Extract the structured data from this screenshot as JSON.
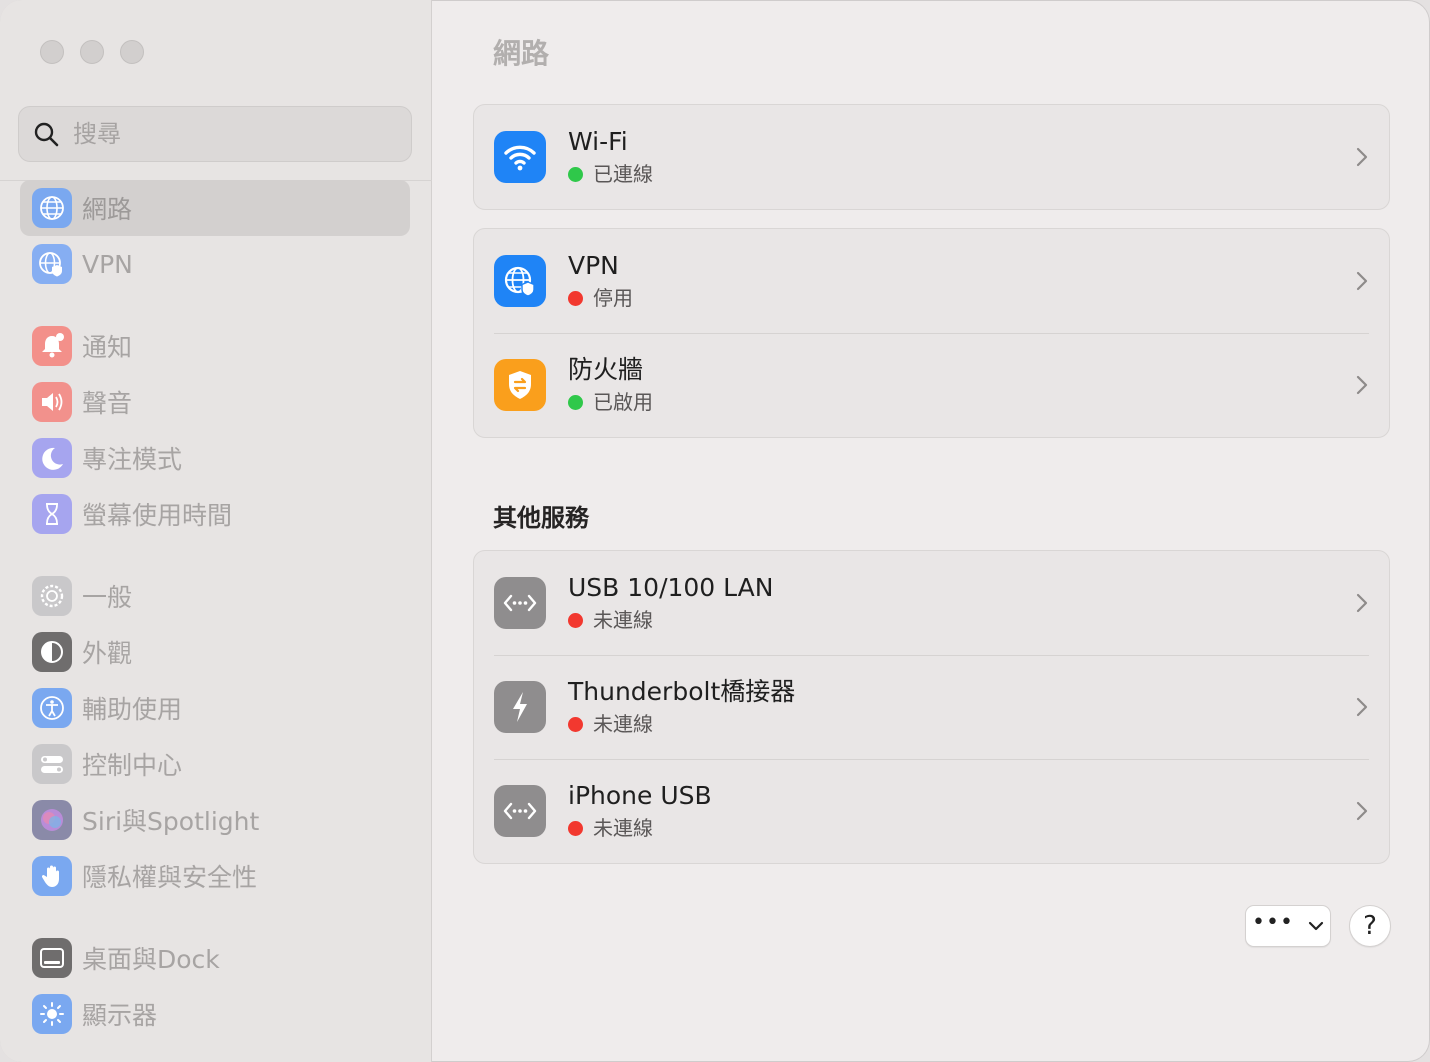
{
  "window": {
    "title": "網路"
  },
  "search": {
    "placeholder": "搜尋"
  },
  "sidebar": {
    "items": [
      {
        "label": "網路",
        "icon": "globe-icon",
        "color": "#2f7cf6",
        "selected": true
      },
      {
        "label": "VPN",
        "icon": "vpn-globe-icon",
        "color": "#2f7cf6"
      },
      {
        "label": "通知",
        "icon": "bell-icon",
        "color": "#f0453a"
      },
      {
        "label": "聲音",
        "icon": "speaker-icon",
        "color": "#f0453a"
      },
      {
        "label": "專注模式",
        "icon": "moon-icon",
        "color": "#5e5ce6"
      },
      {
        "label": "螢幕使用時間",
        "icon": "hourglass-icon",
        "color": "#5e5ce6"
      },
      {
        "label": "一般",
        "icon": "gear-icon",
        "color": "#9a9a9e"
      },
      {
        "label": "外觀",
        "icon": "appearance-icon",
        "color": "#1c1c1e"
      },
      {
        "label": "輔助使用",
        "icon": "accessibility-icon",
        "color": "#2f7cf6"
      },
      {
        "label": "控制中心",
        "icon": "control-center-icon",
        "color": "#9a9a9e"
      },
      {
        "label": "Siri與Spotlight",
        "icon": "siri-icon",
        "color": "#c251d6"
      },
      {
        "label": "隱私權與安全性",
        "icon": "hand-icon",
        "color": "#2f7cf6"
      },
      {
        "label": "桌面與Dock",
        "icon": "dock-icon",
        "color": "#1c1c1e"
      },
      {
        "label": "顯示器",
        "icon": "sun-icon",
        "color": "#2f7cf6"
      }
    ]
  },
  "main": {
    "title": "網路",
    "services": [
      {
        "name": "Wi-Fi",
        "status": "已連線",
        "status_color": "green",
        "icon": "wifi-icon"
      },
      {
        "name": "VPN",
        "status": "停用",
        "status_color": "red",
        "icon": "vpn-globe-icon"
      },
      {
        "name": "防火牆",
        "status": "已啟用",
        "status_color": "green",
        "icon": "firewall-icon"
      }
    ],
    "other_title": "其他服務",
    "other_services": [
      {
        "name": "USB 10/100 LAN",
        "status": "未連線",
        "status_color": "red",
        "icon": "ethernet-icon"
      },
      {
        "name": "Thunderbolt橋接器",
        "status": "未連線",
        "status_color": "red",
        "icon": "thunderbolt-icon"
      },
      {
        "name": "iPhone USB",
        "status": "未連線",
        "status_color": "red",
        "icon": "ethernet-icon"
      }
    ],
    "more_button": "•••",
    "help_button": "?"
  },
  "colors": {
    "accent": "#2f7cf6",
    "connected": "#2fc84a",
    "disconnected": "#f2382f"
  }
}
